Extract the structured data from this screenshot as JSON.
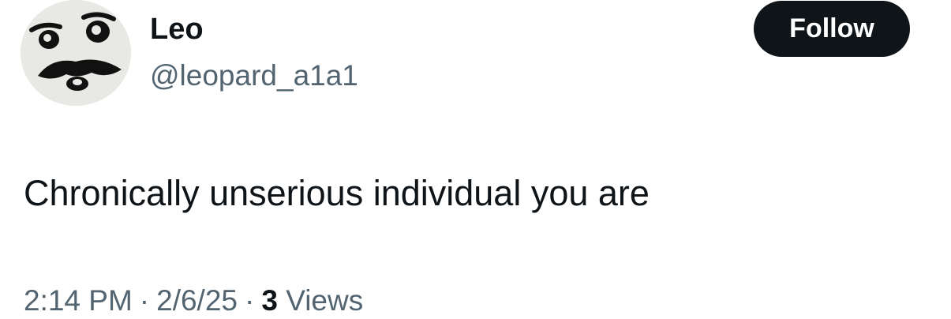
{
  "user": {
    "display_name": "Leo",
    "handle": "@leopard_a1a1",
    "avatar_icon": "meme-face-avatar"
  },
  "actions": {
    "follow_label": "Follow"
  },
  "tweet": {
    "text": "Chronically unserious individual you are"
  },
  "meta": {
    "time": "2:14 PM",
    "separator": "·",
    "date": "2/6/25",
    "views_count": "3",
    "views_label": "Views"
  },
  "colors": {
    "primary_text": "#0f1419",
    "secondary_text": "#536471",
    "button_bg": "#0f1419",
    "button_text": "#ffffff"
  }
}
